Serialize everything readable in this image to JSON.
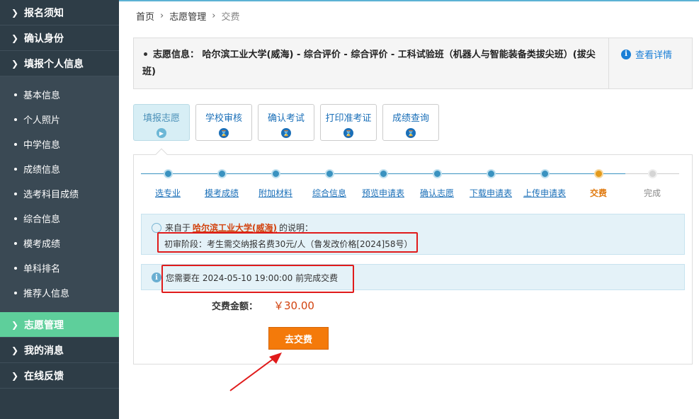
{
  "sidebar": {
    "top_items": [
      {
        "label": "报名须知"
      },
      {
        "label": "确认身份"
      },
      {
        "label": "填报个人信息"
      }
    ],
    "sub_items": [
      {
        "label": "基本信息"
      },
      {
        "label": "个人照片"
      },
      {
        "label": "中学信息"
      },
      {
        "label": "成绩信息"
      },
      {
        "label": "选考科目成绩"
      },
      {
        "label": "综合信息"
      },
      {
        "label": "模考成绩"
      },
      {
        "label": "单科排名"
      },
      {
        "label": "推荐人信息"
      }
    ],
    "bottom_items": [
      {
        "label": "志愿管理",
        "active": true
      },
      {
        "label": "我的消息"
      },
      {
        "label": "在线反馈"
      }
    ]
  },
  "breadcrumb": {
    "home": "首页",
    "level2": "志愿管理",
    "current": "交费"
  },
  "info": {
    "label": "志愿信息：",
    "text": "哈尔滨工业大学(威海) - 综合评价 - 综合评价 - 工科试验班（机器人与智能装备类拔尖班）(拔尖班)",
    "detail_link": "查看详情"
  },
  "tabs": [
    {
      "label": "填报志愿",
      "active": true
    },
    {
      "label": "学校审核"
    },
    {
      "label": "确认考试"
    },
    {
      "label": "打印准考证"
    },
    {
      "label": "成绩查询"
    }
  ],
  "steps": [
    {
      "label": "选专业",
      "state": "done"
    },
    {
      "label": "模考成绩",
      "state": "done"
    },
    {
      "label": "附加材料",
      "state": "done"
    },
    {
      "label": "综合信息",
      "state": "done"
    },
    {
      "label": "预览申请表",
      "state": "done"
    },
    {
      "label": "确认志愿",
      "state": "done"
    },
    {
      "label": "下载申请表",
      "state": "done"
    },
    {
      "label": "上传申请表",
      "state": "done"
    },
    {
      "label": "交费",
      "state": "current"
    },
    {
      "label": "完成",
      "state": "todo"
    }
  ],
  "note1": {
    "prefix": "来自于",
    "university": "哈尔滨工业大学(威海)",
    "suffix": "的说明：",
    "detail": "初审阶段：考生需交纳报名费30元/人（鲁发改价格[2024]58号）"
  },
  "note2": {
    "text": "您需要在 2024-05-10 19:00:00 前完成交费"
  },
  "fee": {
    "label": "交费金额：",
    "value": "￥30.00"
  },
  "pay_button": "去交费",
  "colors": {
    "sidebar_bg": "#2e3d47",
    "sidebar_active": "#5ecf9b",
    "link_blue": "#1a6fb8",
    "accent_orange": "#f47a0a",
    "annotation_red": "#e01b1b"
  }
}
